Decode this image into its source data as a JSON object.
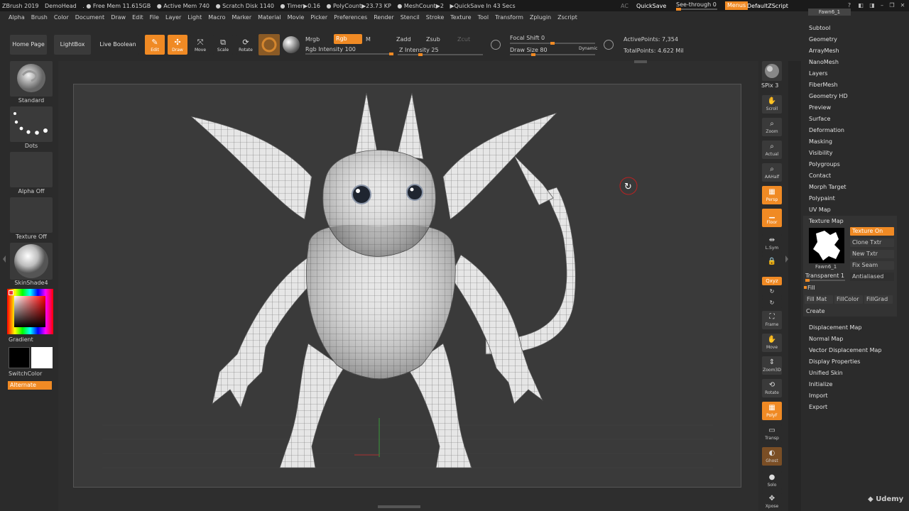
{
  "titlebar": {
    "app": "ZBrush 2019",
    "doc": "DemoHead",
    "free_mem": ". ● Free Mem 11.615GB",
    "active_mem": "● Active Mem 740",
    "scratch": "● Scratch Disk 1140",
    "timer": "● Timer▶0.16",
    "polycount": "● PolyCount▶23.73 KP",
    "meshcount": "● MeshCount▶2",
    "quicksave_info": "▶QuickSave In 43 Secs",
    "ac": "AC",
    "quicksave": "QuickSave",
    "seethrough": "See-through  0",
    "menus": "Menus",
    "script": "DefaultZScript"
  },
  "menubar": [
    "Alpha",
    "Brush",
    "Color",
    "Document",
    "Draw",
    "Edit",
    "File",
    "Layer",
    "Light",
    "Macro",
    "Marker",
    "Material",
    "Movie",
    "Picker",
    "Preferences",
    "Render",
    "Stencil",
    "Stroke",
    "Texture",
    "Tool",
    "Transform",
    "Zplugin",
    "Zscript"
  ],
  "toolbar": {
    "home": "Home Page",
    "lightbox": "LightBox",
    "liveboolean": "Live Boolean",
    "edit": "Edit",
    "draw": "Draw",
    "move": "Move",
    "scale": "Scale",
    "rotate": "Rotate",
    "mrgb": "Mrgb",
    "rgb": "Rgb",
    "m": "M",
    "rgb_intensity": "Rgb Intensity 100",
    "zadd": "Zadd",
    "zsub": "Zsub",
    "zcut": "Zcut",
    "z_intensity": "Z Intensity 25",
    "focal_shift": "Focal Shift 0",
    "draw_size": "Draw Size 80",
    "dynamic": "Dynamic",
    "active_points": "ActivePoints: 7,354",
    "total_points": "TotalPoints: 4.622 Mil",
    "focal_shift_value": 0,
    "draw_size_value": 80,
    "rgb_intensity_value": 100,
    "z_intensity_value": 25
  },
  "leftshelf": {
    "brush": "Standard",
    "stroke": "Dots",
    "alpha": "Alpha Off",
    "texture": "Texture Off",
    "material": "SkinShade4",
    "gradient": "Gradient",
    "switchcolor": "SwitchColor",
    "alternate": "Alternate"
  },
  "rightshelf": {
    "bpr": "BPR",
    "spix": "SPix 3",
    "scroll": "Scroll",
    "zoom": "Zoom",
    "actual": "Actual",
    "aahalf": "AAHalf",
    "persp": "Persp",
    "floor": "Floor",
    "lsym": "L.Sym",
    "xyz": "Qxyz",
    "frame": "Frame",
    "move": "Move",
    "zoom3d": "Zoom3D",
    "rotate": "Rotate",
    "polyf": "PolyF",
    "transp": "Transp",
    "ghost": "Ghost",
    "solo": "Solo",
    "xpose": "Xpose"
  },
  "palette": {
    "tool_name": "Fawn6_1",
    "items": [
      "Subtool",
      "Geometry",
      "ArrayMesh",
      "NanoMesh",
      "Layers",
      "FiberMesh",
      "Geometry HD",
      "Preview",
      "Surface",
      "Deformation",
      "Masking",
      "Visibility",
      "Polygroups",
      "Contact",
      "Morph Target",
      "Polypaint",
      "UV Map"
    ],
    "texture_map": {
      "title": "Texture Map",
      "texture_on": "Texture On",
      "clone_txtr": "Clone Txtr",
      "new_txtr": "New Txtr",
      "fix_seam": "Fix Seam",
      "antialiased": "Antialiased",
      "thumb_label": "Fawn6_1",
      "transparent": "Transparent 1",
      "fill": "Fill",
      "fill_mat": "Fill Mat",
      "fill_color": "FillColor",
      "fill_grad": "FillGrad",
      "create": "Create"
    },
    "items2": [
      "Displacement Map",
      "Normal Map",
      "Vector Displacement Map",
      "Display Properties",
      "Unified Skin",
      "Initialize",
      "Import",
      "Export"
    ]
  },
  "watermark": "Udemy",
  "colors": {
    "accent": "#f08a24",
    "panel": "#2b2b2b",
    "canvas": "#3a3a3a"
  }
}
